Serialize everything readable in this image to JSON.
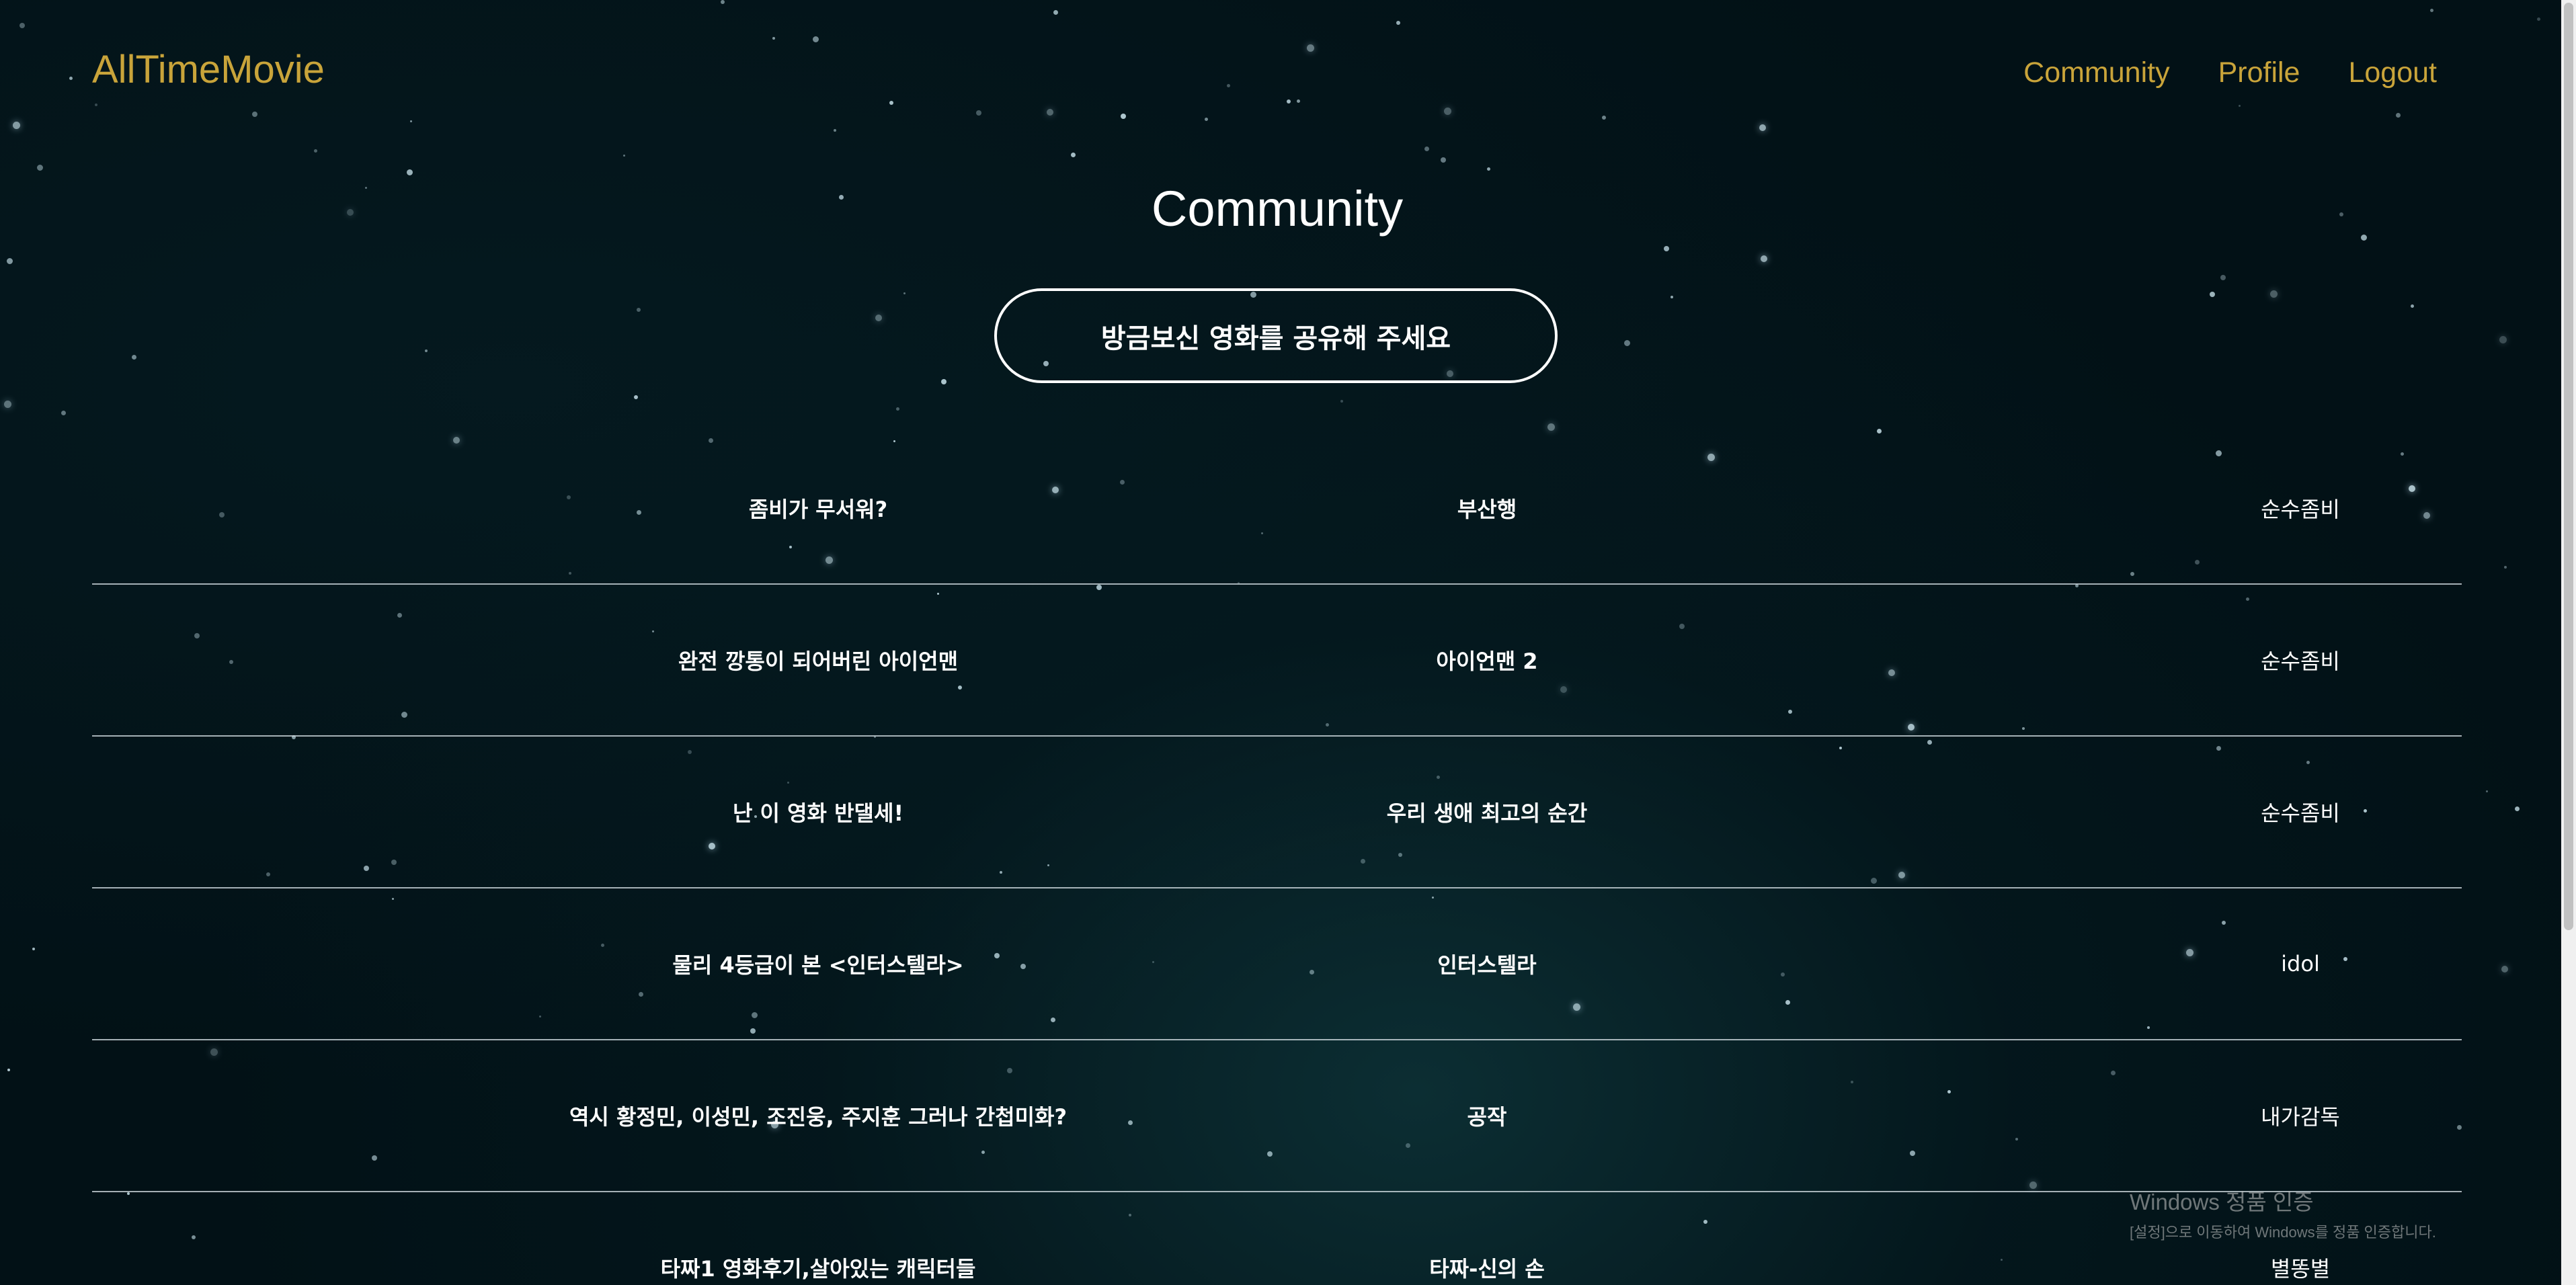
{
  "header": {
    "logo": "AllTimeMovie",
    "nav": [
      "Community",
      "Profile",
      "Logout"
    ]
  },
  "main": {
    "title": "Community",
    "share_button": "방금보신 영화를 공유해 주세요",
    "posts": [
      {
        "title": "좀비가 무서워?",
        "movie": "부산행",
        "author": "순수좀비"
      },
      {
        "title": "완전 깡통이 되어버린 아이언맨",
        "movie": "아이언맨 2",
        "author": "순수좀비"
      },
      {
        "title": "난 이 영화 반댈세!",
        "movie": "우리 생애 최고의 순간",
        "author": "순수좀비"
      },
      {
        "title": "물리 4등급이 본 <인터스텔라>",
        "movie": "인터스텔라",
        "author": "idol"
      },
      {
        "title": "역시 황정민, 이성민, 조진웅, 주지훈 그러나 간첩미화?",
        "movie": "공작",
        "author": "내가감독"
      },
      {
        "title": "타짜1 영화후기,살아있는 캐릭터들",
        "movie": "타짜-신의 손",
        "author": "별똥별"
      }
    ]
  },
  "watermark": {
    "title": "Windows 정품 인증",
    "subtitle": "[설정]으로 이동하여 Windows를 정품 인증합니다."
  },
  "colors": {
    "accent": "#c9a43a",
    "background": "#021116",
    "text": "#ffffff"
  }
}
